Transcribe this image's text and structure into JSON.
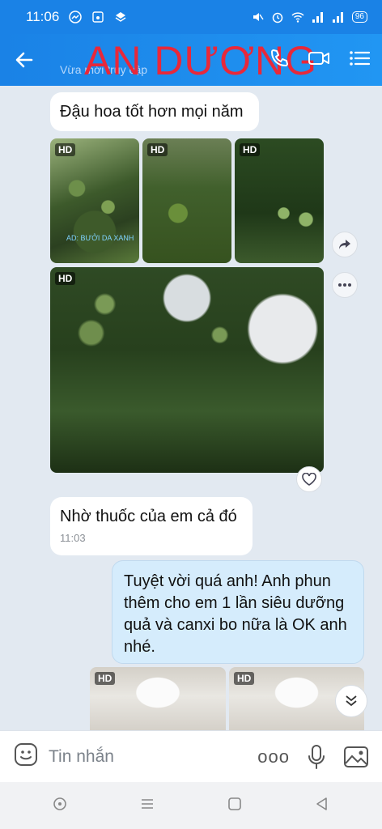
{
  "status_bar": {
    "time": "11:06",
    "battery": "96"
  },
  "header": {
    "contact_name": "AN DƯƠNG",
    "subtitle": "Vừa mới truy cập"
  },
  "messages": {
    "m1": {
      "text": "Đậu hoa tốt hơn mọi năm"
    },
    "photos": {
      "hd_label": "HD",
      "watermark": "AD: BƯỞI DA XANH"
    },
    "m2": {
      "text": "Nhờ thuốc của em cả đó",
      "time": "11:03"
    },
    "m3": {
      "text": "Tuyệt vời quá anh!  Anh phun thêm cho em 1 lần siêu dưỡng quả và canxi bo nữa là OK anh nhé."
    }
  },
  "composer": {
    "placeholder": "Tin nhắn",
    "more_label": "ooo"
  },
  "colors": {
    "accent": "#1a82e6",
    "name_overlay": "#e8283a",
    "my_bubble": "#d5ecfc"
  }
}
